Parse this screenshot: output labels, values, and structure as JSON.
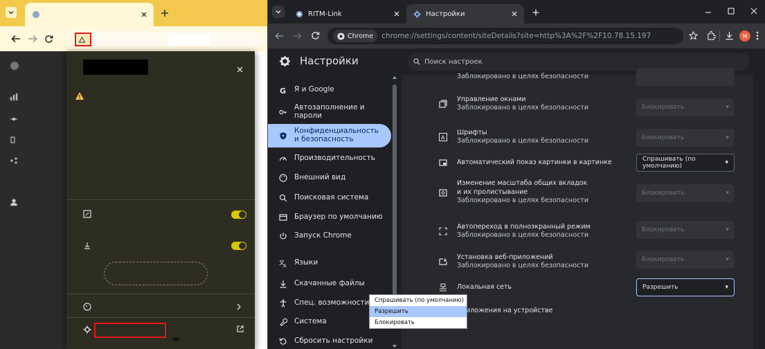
{
  "left_window": {
    "tab_title": "",
    "address_chip": "",
    "address_url": "",
    "popup": {
      "warning_text": "",
      "secondary_text": "",
      "learn_more": "",
      "permission_1_label": "",
      "permission_1_sub": "",
      "permission_2_label": "",
      "reset_button": "",
      "cookies_label": "",
      "site_settings_label": "",
      "open_in_new_tab": ""
    },
    "sidebar_items": [
      "",
      "",
      "",
      "",
      "",
      ""
    ]
  },
  "right_window": {
    "tabs": [
      {
        "label": "RITM-Link",
        "active": false
      },
      {
        "label": "Настройки",
        "active": true
      }
    ],
    "omnibox": {
      "chip": "Chrome",
      "url": "chrome://settings/content/siteDetails?site=http%3A%2F%2F10.78.15.197"
    },
    "profile_letter": "M",
    "app_title": "Настройки",
    "search_placeholder": "Поиск настроек",
    "nav": [
      {
        "label": "Я и Google",
        "icon": "google-icon"
      },
      {
        "label": "Автозаполнение и пароли",
        "icon": "key-icon"
      },
      {
        "label": "Конфиденциальность и безопасность",
        "icon": "shield-icon",
        "active": true
      },
      {
        "label": "Производительность",
        "icon": "speedometer-icon"
      },
      {
        "label": "Внешний вид",
        "icon": "palette-icon"
      },
      {
        "label": "Поисковая система",
        "icon": "search-icon"
      },
      {
        "label": "Браузер по умолчанию",
        "icon": "browser-icon"
      },
      {
        "label": "Запуск Chrome",
        "icon": "power-icon"
      },
      {
        "label": "Языки",
        "icon": "translate-icon"
      },
      {
        "label": "Скачанные файлы",
        "icon": "download-icon"
      },
      {
        "label": "Спец. возможности",
        "icon": "accessibility-icon"
      },
      {
        "label": "Система",
        "icon": "wrench-icon"
      },
      {
        "label": "Сбросить настройки",
        "icon": "reset-icon"
      }
    ],
    "settings": {
      "top_sub": "Заблокировано в целях безопасности",
      "rows": [
        {
          "label": "Управление окнами",
          "sub": "Заблокировано в целях безопасности",
          "value": "Блокировать",
          "state": "disabled",
          "icon": "window-management-icon"
        },
        {
          "label": "Шрифты",
          "sub": "Заблокировано в целях безопасности",
          "value": "Блокировать",
          "state": "disabled",
          "icon": "font-icon"
        },
        {
          "label": "Автоматический показ картинки в картинке",
          "sub": "",
          "value": "Спрашивать (по умолчанию)",
          "state": "enabled",
          "icon": "picture-in-picture-icon"
        },
        {
          "label": "Изменение масштаба общих вкладок и их пролистывание",
          "sub": "Заблокировано в целях безопасности",
          "value": "Блокировать",
          "state": "disabled",
          "icon": "zoom-tab-icon"
        },
        {
          "label": "Автопереход в полноэкранный режим",
          "sub": "Заблокировано в целях безопасности",
          "value": "Блокировать",
          "state": "disabled",
          "icon": "fullscreen-icon"
        },
        {
          "label": "Установка веб-приложений",
          "sub": "Заблокировано в целях безопасности",
          "value": "Блокировать",
          "state": "disabled",
          "icon": "install-app-icon"
        },
        {
          "label": "Локальная сеть",
          "sub": "",
          "value": "Разрешить",
          "state": "focused",
          "icon": "local-network-icon"
        },
        {
          "label": "Приложения на устройстве",
          "sub": "",
          "value": "",
          "state": "none",
          "icon": "device-apps-icon"
        }
      ],
      "dropdown_options": [
        "Спрашивать (по умолчанию)",
        "Разрешить",
        "Блокировать"
      ],
      "dropdown_highlighted": "Разрешить"
    }
  },
  "colors": {
    "left_tabbar": "#f2c94c",
    "popup_bg": "#2d2d22",
    "toggle": "#d6c800",
    "settings_bg": "#1f2023",
    "card_bg": "#28292c",
    "accent": "#a8c7fa",
    "highlight_red": "#e31919"
  }
}
